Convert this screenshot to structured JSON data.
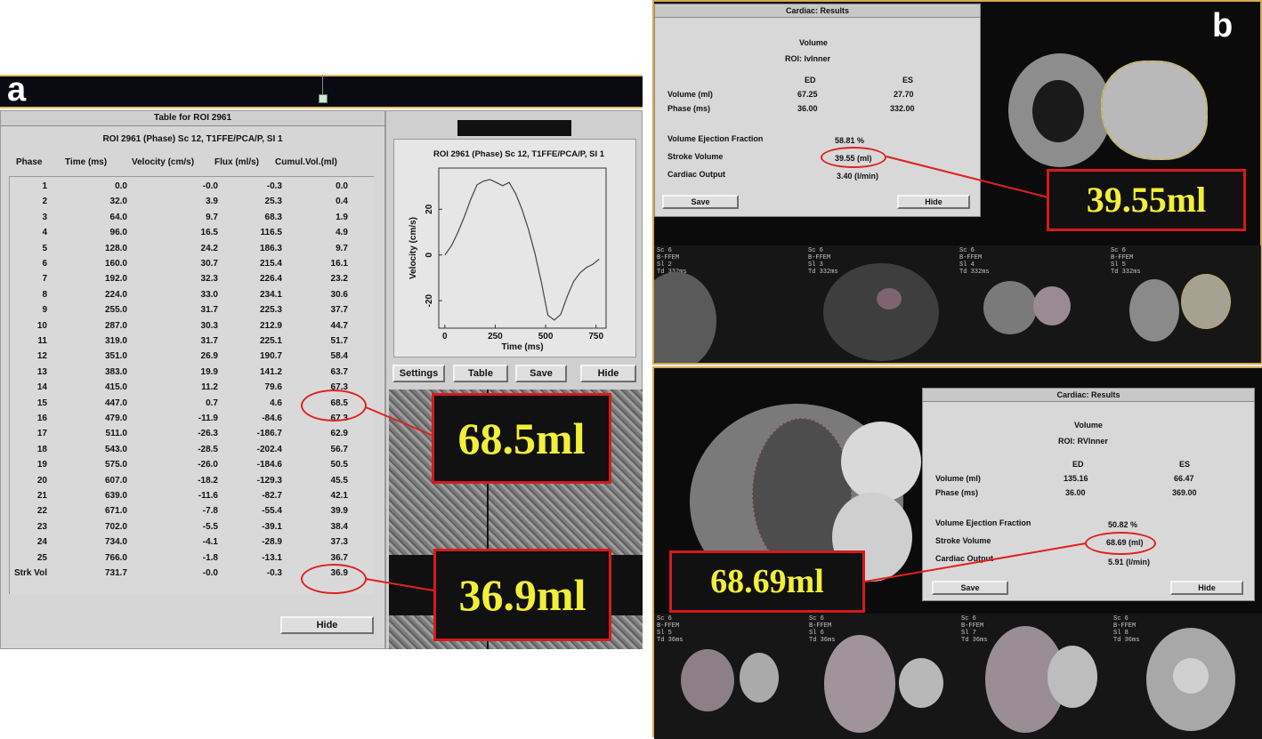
{
  "panel_a": {
    "letter": "a",
    "window_title": "Table for ROI 2961",
    "subtitle": "ROI 2961 (Phase) Sc 12, T1FFE/PCA/P, SI 1",
    "columns": [
      "Phase",
      "Time (ms)",
      "Velocity (cm/s)",
      "Flux (ml/s)",
      "Cumul.Vol.(ml)"
    ],
    "rows": [
      [
        "1",
        "0.0",
        "-0.0",
        "-0.3",
        "0.0"
      ],
      [
        "2",
        "32.0",
        "3.9",
        "25.3",
        "0.4"
      ],
      [
        "3",
        "64.0",
        "9.7",
        "68.3",
        "1.9"
      ],
      [
        "4",
        "96.0",
        "16.5",
        "116.5",
        "4.9"
      ],
      [
        "5",
        "128.0",
        "24.2",
        "186.3",
        "9.7"
      ],
      [
        "6",
        "160.0",
        "30.7",
        "215.4",
        "16.1"
      ],
      [
        "7",
        "192.0",
        "32.3",
        "226.4",
        "23.2"
      ],
      [
        "8",
        "224.0",
        "33.0",
        "234.1",
        "30.6"
      ],
      [
        "9",
        "255.0",
        "31.7",
        "225.3",
        "37.7"
      ],
      [
        "10",
        "287.0",
        "30.3",
        "212.9",
        "44.7"
      ],
      [
        "11",
        "319.0",
        "31.7",
        "225.1",
        "51.7"
      ],
      [
        "12",
        "351.0",
        "26.9",
        "190.7",
        "58.4"
      ],
      [
        "13",
        "383.0",
        "19.9",
        "141.2",
        "63.7"
      ],
      [
        "14",
        "415.0",
        "11.2",
        "79.6",
        "67.3"
      ],
      [
        "15",
        "447.0",
        "0.7",
        "4.6",
        "68.5"
      ],
      [
        "16",
        "479.0",
        "-11.9",
        "-84.6",
        "67.3"
      ],
      [
        "17",
        "511.0",
        "-26.3",
        "-186.7",
        "62.9"
      ],
      [
        "18",
        "543.0",
        "-28.5",
        "-202.4",
        "56.7"
      ],
      [
        "19",
        "575.0",
        "-26.0",
        "-184.6",
        "50.5"
      ],
      [
        "20",
        "607.0",
        "-18.2",
        "-129.3",
        "45.5"
      ],
      [
        "21",
        "639.0",
        "-11.6",
        "-82.7",
        "42.1"
      ],
      [
        "22",
        "671.0",
        "-7.8",
        "-55.4",
        "39.9"
      ],
      [
        "23",
        "702.0",
        "-5.5",
        "-39.1",
        "38.4"
      ],
      [
        "24",
        "734.0",
        "-4.1",
        "-28.9",
        "37.3"
      ],
      [
        "25",
        "766.0",
        "-1.8",
        "-13.1",
        "36.7"
      ],
      [
        "Strk Vol",
        "731.7",
        "-0.0",
        "-0.3",
        "36.9"
      ]
    ],
    "hide_label": "Hide",
    "buttons": [
      "Settings",
      "Table",
      "Save",
      "Hide"
    ],
    "callout_top": "68.5ml",
    "callout_bottom": "36.9ml"
  },
  "chart_data": {
    "type": "line",
    "title": "ROI 2961 (Phase) Sc 12, T1FFE/PCA/P, SI 1",
    "xlabel": "Time (ms)",
    "ylabel": "Velocity (cm/s)",
    "xlim": [
      -30,
      800
    ],
    "ylim": [
      -32,
      38
    ],
    "xticks": [
      0,
      250,
      500,
      750
    ],
    "yticks": [
      -20,
      0,
      20
    ],
    "x": [
      0,
      32,
      64,
      96,
      128,
      160,
      192,
      224,
      255,
      287,
      319,
      351,
      383,
      415,
      447,
      479,
      511,
      543,
      575,
      607,
      639,
      671,
      702,
      734,
      766
    ],
    "y": [
      -0.0,
      3.9,
      9.7,
      16.5,
      24.2,
      30.7,
      32.3,
      33.0,
      31.7,
      30.3,
      31.7,
      26.9,
      19.9,
      11.2,
      0.7,
      -11.9,
      -26.3,
      -28.5,
      -26.0,
      -18.2,
      -11.6,
      -7.8,
      -5.5,
      -4.1,
      -1.8
    ],
    "grid": false,
    "line_color": "#444444"
  },
  "panel_b": {
    "letter": "b",
    "top_dialog": {
      "title": "Cardiac: Results",
      "heading": "Volume",
      "roi": "ROI: lvInner",
      "col_ed": "ED",
      "col_es": "ES",
      "volume_label": "Volume (ml)",
      "volume_ed": "67.25",
      "volume_es": "27.70",
      "phase_label": "Phase (ms)",
      "phase_ed": "36.00",
      "phase_es": "332.00",
      "ef_label": "Volume Ejection Fraction",
      "ef_value": "58.81 %",
      "sv_label": "Stroke Volume",
      "sv_value": "39.55 (ml)",
      "co_label": "Cardiac Output",
      "co_value": "3.40 (l/min)",
      "save": "Save",
      "hide": "Hide"
    },
    "top_callout": "39.55ml",
    "bottom_dialog": {
      "title": "Cardiac: Results",
      "heading": "Volume",
      "roi": "ROI: RVInner",
      "col_ed": "ED",
      "col_es": "ES",
      "volume_label": "Volume (ml)",
      "volume_ed": "135.16",
      "volume_es": "66.47",
      "phase_label": "Phase (ms)",
      "phase_ed": "36.00",
      "phase_es": "369.00",
      "ef_label": "Volume Ejection Fraction",
      "ef_value": "50.82 %",
      "sv_label": "Stroke Volume",
      "sv_value": "68.69 (ml)",
      "co_label": "Cardiac Output",
      "co_value": "5.91 (l/min)",
      "save": "Save",
      "hide": "Hide"
    },
    "bottom_callout": "68.69ml",
    "thumb_labels": [
      "Sc 6\nB-FFEM\nSl 2\nTd 332ms",
      "Sc 6\nB-FFEM\nSl 3\nTd 332ms",
      "Sc 6\nB-FFEM\nSl 4\nTd 332ms",
      "Sc 6\nB-FFEM\nSl 5\nTd 332ms"
    ],
    "thumb_labels_bottom": [
      "Sc 6\nB-FFEM\nSl 5\nTd 36ms",
      "Sc 6\nB-FFEM\nSl 6\nTd 36ms",
      "Sc 6\nB-FFEM\nSl 7\nTd 36ms",
      "Sc 6\nB-FFEM\nSl 8\nTd 36ms"
    ]
  }
}
